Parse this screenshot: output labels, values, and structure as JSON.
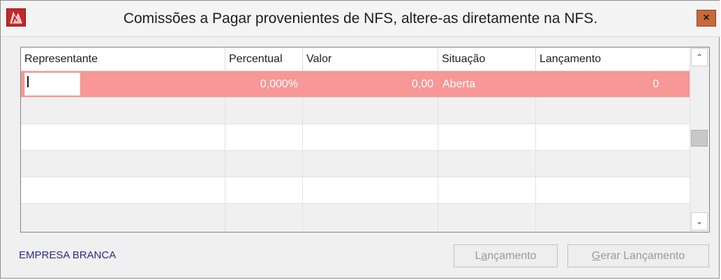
{
  "window": {
    "title": "Comissões a Pagar provenientes de NFS, altere-as diretamente na NFS.",
    "close_glyph": "×",
    "icon": "app-logo-icon"
  },
  "grid": {
    "columns": [
      "Representante",
      "Percentual",
      "Valor",
      "Situação",
      "Lançamento"
    ],
    "rows": [
      {
        "representante": "",
        "percentual": "0,000%",
        "valor": "0,00",
        "situacao": "Aberta",
        "lancamento": "0"
      }
    ],
    "selected_row_color": "#f79797"
  },
  "scrollbar": {
    "up_icon": "chevron-up-icon",
    "down_icon": "chevron-down-icon",
    "up_glyph": "⌃",
    "down_glyph": "⌄"
  },
  "footer": {
    "company": "EMPRESA BRANCA",
    "btn_lancamento_first": "L",
    "btn_lancamento_hot": "a",
    "btn_lancamento_rest": "nçamento",
    "btn_gerar_hot": "G",
    "btn_gerar_rest": "erar Lançamento"
  }
}
